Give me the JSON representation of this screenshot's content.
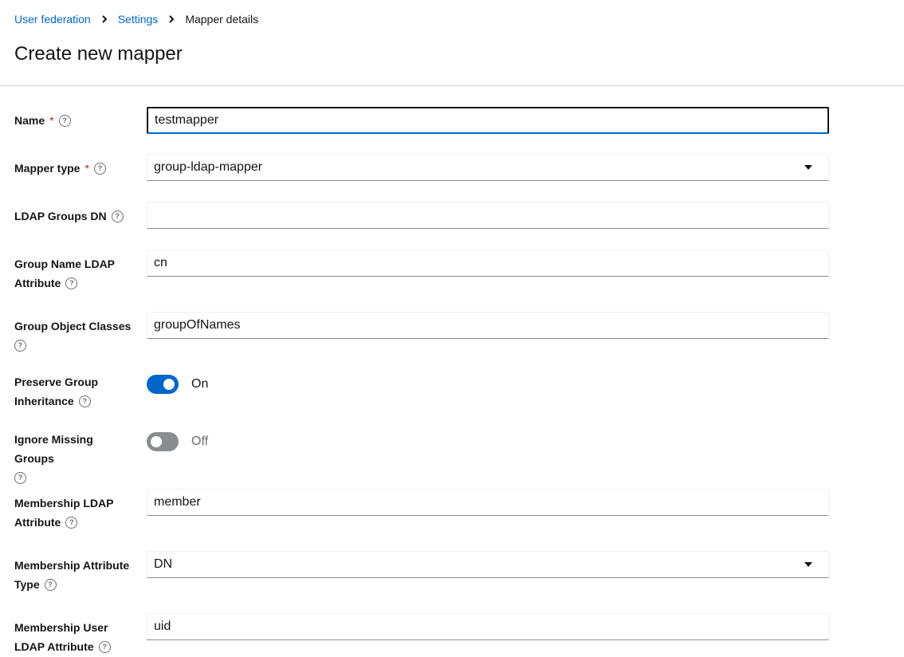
{
  "breadcrumb": {
    "items": [
      "User federation",
      "Settings"
    ],
    "current": "Mapper details"
  },
  "page": {
    "title": "Create new mapper"
  },
  "form": {
    "name": {
      "label": "Name",
      "required": true,
      "value": "testmapper"
    },
    "mapper_type": {
      "label": "Mapper type",
      "required": true,
      "value": "group-ldap-mapper"
    },
    "ldap_groups_dn": {
      "label": "LDAP Groups DN",
      "value": ""
    },
    "group_name_ldap_attribute": {
      "label_line1": "Group Name LDAP",
      "label_line2": "Attribute",
      "value": "cn"
    },
    "group_object_classes": {
      "label": "Group Object Classes",
      "value": "groupOfNames"
    },
    "preserve_group_inheritance": {
      "label_line1": "Preserve Group",
      "label_line2": "Inheritance",
      "state": "On",
      "checked": true
    },
    "ignore_missing_groups": {
      "label": "Ignore Missing Groups",
      "state": "Off",
      "checked": false
    },
    "membership_ldap_attribute": {
      "label_line1": "Membership LDAP",
      "label_line2": "Attribute",
      "value": "member"
    },
    "membership_attribute_type": {
      "label_line1": "Membership Attribute",
      "label_line2": "Type",
      "value": "DN"
    },
    "membership_user_ldap_attribute": {
      "label_line1": "Membership User",
      "label_line2": "LDAP Attribute",
      "value": "uid"
    }
  },
  "colors": {
    "accent": "#0066cc",
    "required": "#c9190b",
    "toggle_off": "#8a8d90"
  },
  "icons": {
    "breadcrumb_separator": "chevron-right-icon",
    "help": "help-icon",
    "dropdown": "caret-down-icon"
  }
}
